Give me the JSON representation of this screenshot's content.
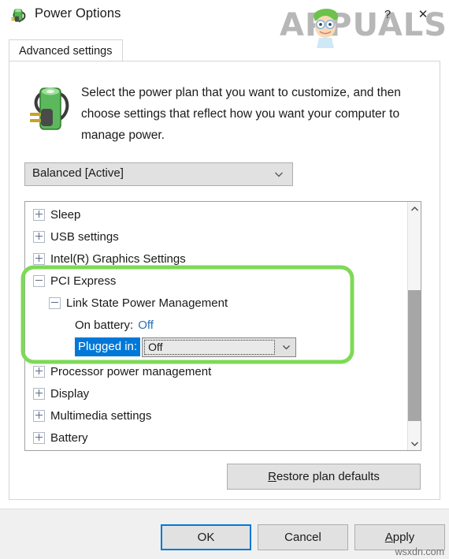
{
  "window": {
    "title": "Power Options",
    "icon": "battery-plug-icon",
    "help_label": "?",
    "close_label": "✕"
  },
  "watermark": {
    "logo_text": "APPUALS",
    "bottom_text": "wsxdn.com"
  },
  "tabs": [
    {
      "label": "Advanced settings",
      "selected": true
    }
  ],
  "intro": {
    "icon": "battery-plug-icon",
    "text": "Select the power plan that you want to customize, and then choose settings that reflect how you want your computer to manage power."
  },
  "plan_select": {
    "value": "Balanced [Active]",
    "arrow": "chevron-down-icon"
  },
  "settings_tree": [
    {
      "label": "Sleep",
      "state": "collapsed",
      "indent": 0
    },
    {
      "label": "USB settings",
      "state": "collapsed",
      "indent": 0
    },
    {
      "label": "Intel(R) Graphics Settings",
      "state": "collapsed",
      "indent": 0
    },
    {
      "label": "PCI Express",
      "state": "expanded",
      "indent": 0
    },
    {
      "label": "Link State Power Management",
      "state": "expanded",
      "indent": 1
    },
    {
      "label": "On battery:",
      "value": "Off",
      "state": "leaf",
      "indent": 2
    },
    {
      "label": "Plugged in:",
      "value": "Off",
      "state": "leaf-selected",
      "indent": 2
    },
    {
      "label": "Processor power management",
      "state": "collapsed",
      "indent": 0
    },
    {
      "label": "Display",
      "state": "collapsed",
      "indent": 0
    },
    {
      "label": "Multimedia settings",
      "state": "collapsed",
      "indent": 0
    },
    {
      "label": "Battery",
      "state": "collapsed",
      "indent": 0
    }
  ],
  "scrollbar": {
    "up_arrow": "chevron-up-icon",
    "down_arrow": "chevron-down-icon"
  },
  "restore_button": {
    "accel": "R",
    "rest": "estore plan defaults"
  },
  "dialog_buttons": {
    "ok": "OK",
    "cancel": "Cancel",
    "apply_accel": "A",
    "apply_rest": "pply"
  },
  "colors": {
    "selection_blue": "#0078d7",
    "link_blue": "#2a6fb5",
    "highlight_green": "#7ed957",
    "battery_green": "#5cb85c"
  }
}
